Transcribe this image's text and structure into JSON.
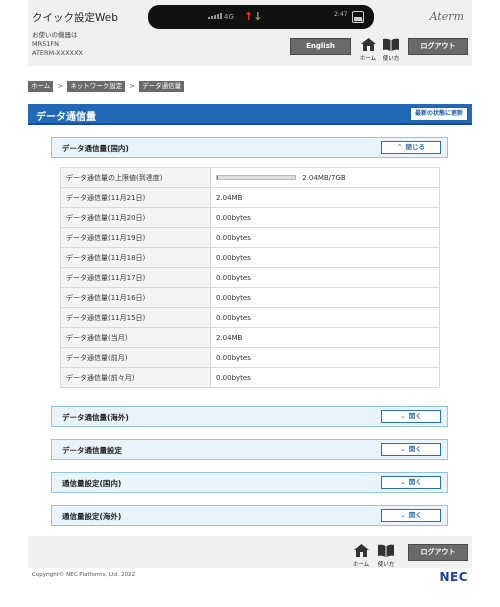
{
  "header": {
    "app_title": "クイック設定Web",
    "device_label": "お使いの機器は",
    "model": "MR51FN",
    "device_name": "ATERM-XXXXXX",
    "brand": "Aterm",
    "english_label": "English",
    "home_label": "ホーム",
    "help_label": "使い方",
    "logout_label": "ログアウト"
  },
  "status_bar": {
    "network": "4G",
    "clock": "2:47",
    "battery": "35%",
    "colors": {
      "upload": "#e53935",
      "download": "#7cb342"
    }
  },
  "breadcrumb": {
    "items": [
      "ホーム",
      "ネットワーク設定",
      "データ通信量"
    ],
    "separator": ">"
  },
  "page": {
    "title": "データ通信量",
    "refresh_label": "最新の状態に更新"
  },
  "sections": [
    {
      "label": "データ通信量(国内)",
      "button": "閉じる",
      "expanded": true
    },
    {
      "label": "データ通信量(海外)",
      "button": "開く",
      "expanded": false
    },
    {
      "label": "データ通信量設定",
      "button": "開く",
      "expanded": false
    },
    {
      "label": "通信量設定(国内)",
      "button": "開く",
      "expanded": false
    },
    {
      "label": "通信量設定(海外)",
      "button": "開く",
      "expanded": false
    }
  ],
  "usage": {
    "limit_label": "データ通信量の上限値(到達度)",
    "limit_value": "2.04MB/7GB",
    "limit_fraction": 0.0003,
    "rows": [
      {
        "label": "データ通信量(11月21日)",
        "value": "2.04MB"
      },
      {
        "label": "データ通信量(11月20日)",
        "value": "0.00bytes"
      },
      {
        "label": "データ通信量(11月19日)",
        "value": "0.00bytes"
      },
      {
        "label": "データ通信量(11月18日)",
        "value": "0.00bytes"
      },
      {
        "label": "データ通信量(11月17日)",
        "value": "0.00bytes"
      },
      {
        "label": "データ通信量(11月16日)",
        "value": "0.00bytes"
      },
      {
        "label": "データ通信量(11月15日)",
        "value": "0.00bytes"
      },
      {
        "label": "データ通信量(当月)",
        "value": "2.04MB"
      },
      {
        "label": "データ通信量(前月)",
        "value": "0.00bytes"
      },
      {
        "label": "データ通信量(前々月)",
        "value": "0.00bytes"
      }
    ]
  },
  "footer": {
    "home_label": "ホーム",
    "help_label": "使い方",
    "logout_label": "ログアウト",
    "copyright": "Copyright© NEC Platforms, Ltd. 2022",
    "logo": "NEC"
  }
}
